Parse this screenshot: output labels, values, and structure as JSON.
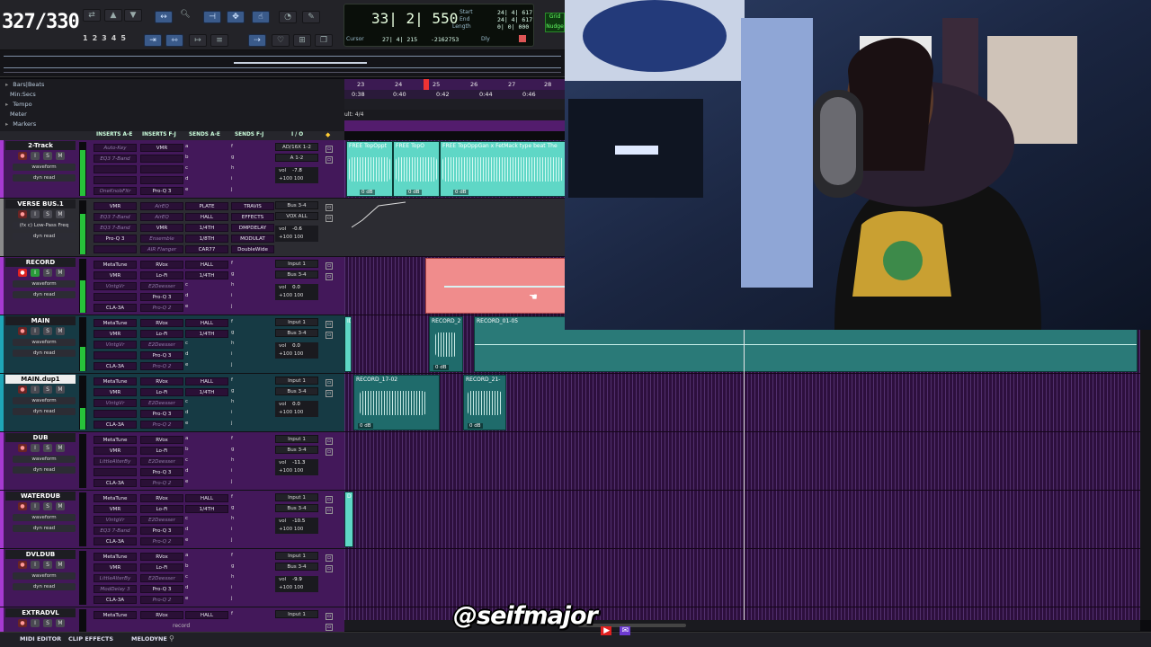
{
  "toolbar": {
    "counter_overlay": "327/330",
    "tool_numbers": [
      "1",
      "2",
      "3",
      "4",
      "5"
    ],
    "main_counter": "33| 2| 550",
    "labels": {
      "start": "Start",
      "end": "End",
      "length": "Length",
      "cursor": "Cursor"
    },
    "start_value": "24| 4| 617",
    "end_value": "24| 4| 617",
    "length_value": "0| 0| 000",
    "cursor_value": "27| 4| 215",
    "cursor_extra": "-2162753",
    "dly_label": "Dly",
    "grid_label": "Grid",
    "nudge_label": "Nudge"
  },
  "rulers": {
    "rows": [
      "Bars|Beats",
      "Min:Secs",
      "Tempo",
      "Meter",
      "Markers"
    ],
    "bar_ticks": [
      "23",
      "24",
      "25",
      "26",
      "27",
      "28"
    ],
    "sec_ticks": [
      "0:38",
      "0:40",
      "0:42",
      "0:44",
      "0:46"
    ],
    "meter_text": "ult: 4/4"
  },
  "column_headers": [
    "INSERTS A-E",
    "INSERTS F-J",
    "SENDS A-E",
    "SENDS F-J",
    "I / O"
  ],
  "tracks": [
    {
      "name": "2-Track",
      "mini_rows": [
        "waveform",
        "dyn  read"
      ],
      "inserts_ae": [
        "Auto-Key",
        "EQ3 7-Band",
        "",
        "",
        "OneKnobFltr"
      ],
      "inserts_fj": [
        "VMR",
        "",
        "",
        "",
        "Pro-Q 3"
      ],
      "sends_ae": [
        "a",
        "b",
        "c",
        "d",
        "e"
      ],
      "sends_fj": [
        "f",
        "g",
        "h",
        "i",
        "j"
      ],
      "io_in": "AD/16X 1-2",
      "io_out": "A 1-2",
      "vol": "-7.8",
      "pan": "+100  100"
    },
    {
      "name": "VERSE BUS.1",
      "mini_rows": [
        "(fx c) Low-Pass Freq",
        "dyn  read"
      ],
      "inserts_ae": [
        "VMR",
        "EQ3 7-Band",
        "EQ3 7-Band",
        "Pro-Q 3",
        ""
      ],
      "inserts_fj": [
        "AirEQ",
        "AirEQ",
        "VMR",
        "Ensemble",
        "AIR Flanger"
      ],
      "sends_ae": [
        "PLATE",
        "HALL",
        "1/4TH",
        "1/8TH",
        "CAR77"
      ],
      "sends_fj": [
        "TRAVIS",
        "EFFECTS",
        "DMPDELAY",
        "MODULAT",
        "DoubleWide"
      ],
      "io_in": "Bus 3-4",
      "io_out": "VOX ALL",
      "vol": "-0.6",
      "pan": "+100  100"
    },
    {
      "name": "RECORD",
      "mini_rows": [
        "waveform",
        "dyn  read"
      ],
      "inserts_ae": [
        "MetaTune",
        "VMR",
        "VintgVr",
        "",
        "CLA-3A"
      ],
      "inserts_fj": [
        "RVox",
        "Lo-Fi",
        "E2Deesser",
        "Pro-Q 3",
        "Pro-Q 2"
      ],
      "sends_ae": [
        "HALL",
        "1/4TH",
        "c",
        "d",
        "e"
      ],
      "sends_fj": [
        "f",
        "g",
        "h",
        "i",
        "j"
      ],
      "io_in": "Input 1",
      "io_out": "Bus 3-4",
      "vol": "0.0",
      "pan": "+100  100"
    },
    {
      "name": "MAIN",
      "mini_rows": [
        "waveform",
        "dyn  read"
      ],
      "inserts_ae": [
        "MetaTune",
        "VMR",
        "VintgVr",
        "",
        "CLA-3A"
      ],
      "inserts_fj": [
        "RVox",
        "Lo-Fi",
        "E2Deesser",
        "Pro-Q 3",
        "Pro-Q 2"
      ],
      "sends_ae": [
        "HALL",
        "1/4TH",
        "c",
        "d",
        "e"
      ],
      "sends_fj": [
        "f",
        "g",
        "h",
        "i",
        "j"
      ],
      "io_in": "Input 1",
      "io_out": "Bus 3-4",
      "vol": "0.0",
      "pan": "+100  100"
    },
    {
      "name": "MAIN.dup1",
      "mini_rows": [
        "waveform",
        "dyn  read"
      ],
      "inserts_ae": [
        "MetaTune",
        "VMR",
        "VintgVr",
        "",
        "CLA-3A"
      ],
      "inserts_fj": [
        "RVox",
        "Lo-Fi",
        "E2Deesser",
        "Pro-Q 3",
        "Pro-Q 2"
      ],
      "sends_ae": [
        "HALL",
        "1/4TH",
        "c",
        "d",
        "e"
      ],
      "sends_fj": [
        "f",
        "g",
        "h",
        "i",
        "j"
      ],
      "io_in": "Input 1",
      "io_out": "Bus 3-4",
      "vol": "0.0",
      "pan": "+100  100"
    },
    {
      "name": "DUB",
      "mini_rows": [
        "waveform",
        "dyn  read"
      ],
      "inserts_ae": [
        "MetaTune",
        "VMR",
        "LittleAlterBy",
        "",
        "CLA-3A"
      ],
      "inserts_fj": [
        "RVox",
        "Lo-Fi",
        "E2Deesser",
        "Pro-Q 3",
        "Pro-Q 2"
      ],
      "sends_ae": [
        "a",
        "b",
        "c",
        "d",
        "e"
      ],
      "sends_fj": [
        "f",
        "g",
        "h",
        "i",
        "j"
      ],
      "io_in": "Input 1",
      "io_out": "Bus 3-4",
      "vol": "-11.3",
      "pan": "+100  100"
    },
    {
      "name": "WATERDUB",
      "mini_rows": [
        "waveform",
        "dyn  read"
      ],
      "inserts_ae": [
        "MetaTune",
        "VMR",
        "VintgVr",
        "EQ3 7-Band",
        "CLA-3A"
      ],
      "inserts_fj": [
        "RVox",
        "Lo-Fi",
        "E2Deesser",
        "Pro-Q 3",
        "Pro-Q 2"
      ],
      "sends_ae": [
        "HALL",
        "1/4TH",
        "c",
        "d",
        "e"
      ],
      "sends_fj": [
        "f",
        "g",
        "h",
        "i",
        "j"
      ],
      "io_in": "Input 1",
      "io_out": "Bus 3-4",
      "vol": "-10.5",
      "pan": "+100  100"
    },
    {
      "name": "DVLDUB",
      "mini_rows": [
        "waveform",
        "dyn  read"
      ],
      "inserts_ae": [
        "MetaTune",
        "VMR",
        "LittleAlterBy",
        "ModDelay 3",
        "CLA-3A"
      ],
      "inserts_fj": [
        "RVox",
        "Lo-Fi",
        "E2Deesser",
        "Pro-Q 3",
        "Pro-Q 2"
      ],
      "sends_ae": [
        "a",
        "b",
        "c",
        "d",
        "e"
      ],
      "sends_fj": [
        "f",
        "g",
        "h",
        "i",
        "j"
      ],
      "io_in": "Input 1",
      "io_out": "Bus 3-4",
      "vol": "-9.9",
      "pan": "+100  100"
    },
    {
      "name": "EXTRADVL",
      "mini_rows": [],
      "inserts_ae": [
        "MetaTune"
      ],
      "inserts_fj": [
        "RVox"
      ],
      "sends_ae": [
        "HALL"
      ],
      "sends_fj": [
        "f"
      ],
      "io_in": "Input 1",
      "io_out": "",
      "vol": "",
      "pan": ""
    }
  ],
  "clips": {
    "two_track_1": "FREE TopOppt",
    "two_track_2": "FREE TopO",
    "two_track_3": "FREE TopOppGan x FetMack type beat The",
    "gain_0db": "0 dB",
    "main_clip_1": "RECORD_2",
    "main_clip_2": "RECORD_01-05",
    "dup_clip_1": "RECORD_17-02",
    "dup_clip_2": "RECORD_21-",
    "main_clip_marker": "ID",
    "water_marker": "D"
  },
  "bottom": {
    "tabs": [
      "MIDI EDITOR",
      "CLIP EFFECTS",
      "MELODYNE"
    ],
    "record_label": "record",
    "handle": "@seifmajor"
  },
  "colors": {
    "track_purple": "#43185a",
    "track_teal": "#163a44",
    "clip_cyan": "#5fd7c6",
    "clip_record": "#f08c8c",
    "accent_green": "#27c23a"
  }
}
